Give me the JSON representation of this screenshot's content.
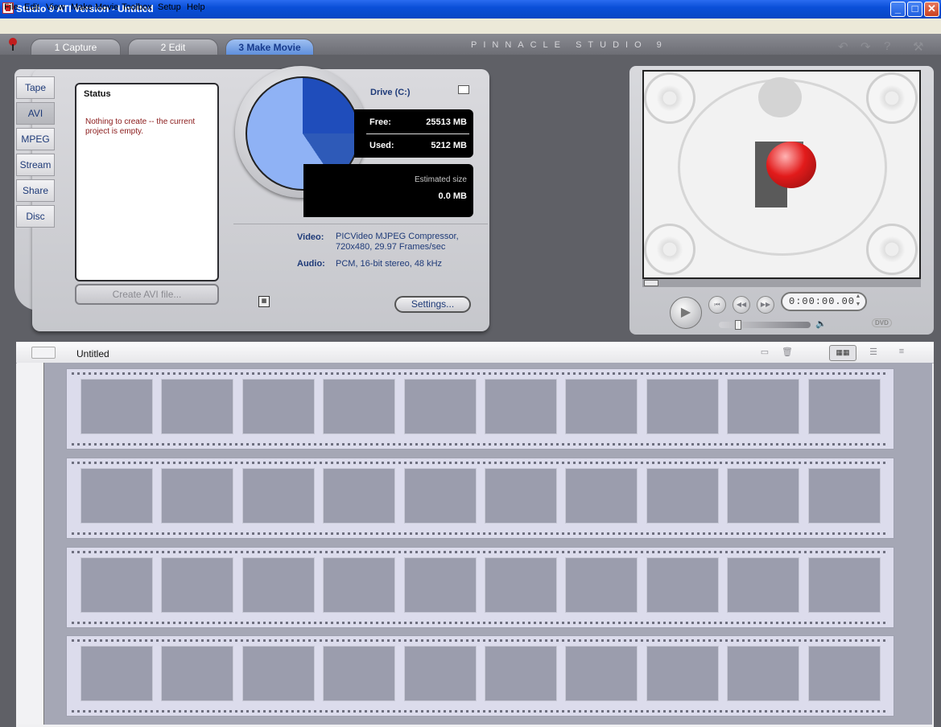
{
  "window": {
    "title": "Studio 9 ATI Version - Untitled",
    "controls": [
      "_",
      "□",
      "✕"
    ]
  },
  "menu": [
    "File",
    "Edit",
    "View",
    "Make Movie",
    "Toolbox",
    "Setup",
    "Help"
  ],
  "tabs": [
    {
      "label": "1 Capture",
      "active": false
    },
    {
      "label": "2 Edit",
      "active": false
    },
    {
      "label": "3 Make Movie",
      "active": true
    }
  ],
  "brand": "PINNACLE STUDIO 9",
  "top_icons": [
    "undo-icon",
    "redo-icon",
    "help-icon",
    "wrench-icon"
  ],
  "side_tabs": [
    {
      "label": "Tape",
      "active": false
    },
    {
      "label": "AVI",
      "active": true
    },
    {
      "label": "MPEG",
      "active": false
    },
    {
      "label": "Stream",
      "active": false
    },
    {
      "label": "Share",
      "active": false
    },
    {
      "label": "Disc",
      "active": false
    }
  ],
  "status": {
    "title": "Status",
    "message": "Nothing to create -- the current project is empty."
  },
  "create_button": "Create AVI file...",
  "drive": {
    "label": "Drive (C:)",
    "free_label": "Free:",
    "free_value": "25513 MB",
    "used_label": "Used:",
    "used_value": "5212 MB",
    "estimated_label": "Estimated size",
    "estimated_value": "0.0 MB"
  },
  "format": {
    "video_label": "Video:",
    "video_value": "PICVideo MJPEG Compressor, 720x480, 29.97 Frames/sec",
    "audio_label": "Audio:",
    "audio_value": "PCM, 16-bit stereo, 48 kHz"
  },
  "settings_button": "Settings...",
  "player": {
    "timecode": "0:00:00.00",
    "dvd_label": "DVD"
  },
  "album": {
    "title": "Untitled",
    "filmstrips": 4,
    "frames_per_strip": 10
  },
  "colors": {
    "accent_tab": "#5f8fdc",
    "panel_text": "#1e3a78",
    "status_message": "#8a1a1a",
    "gauge_free": "#8fb2f5",
    "gauge_used": "#2e5ab8"
  }
}
